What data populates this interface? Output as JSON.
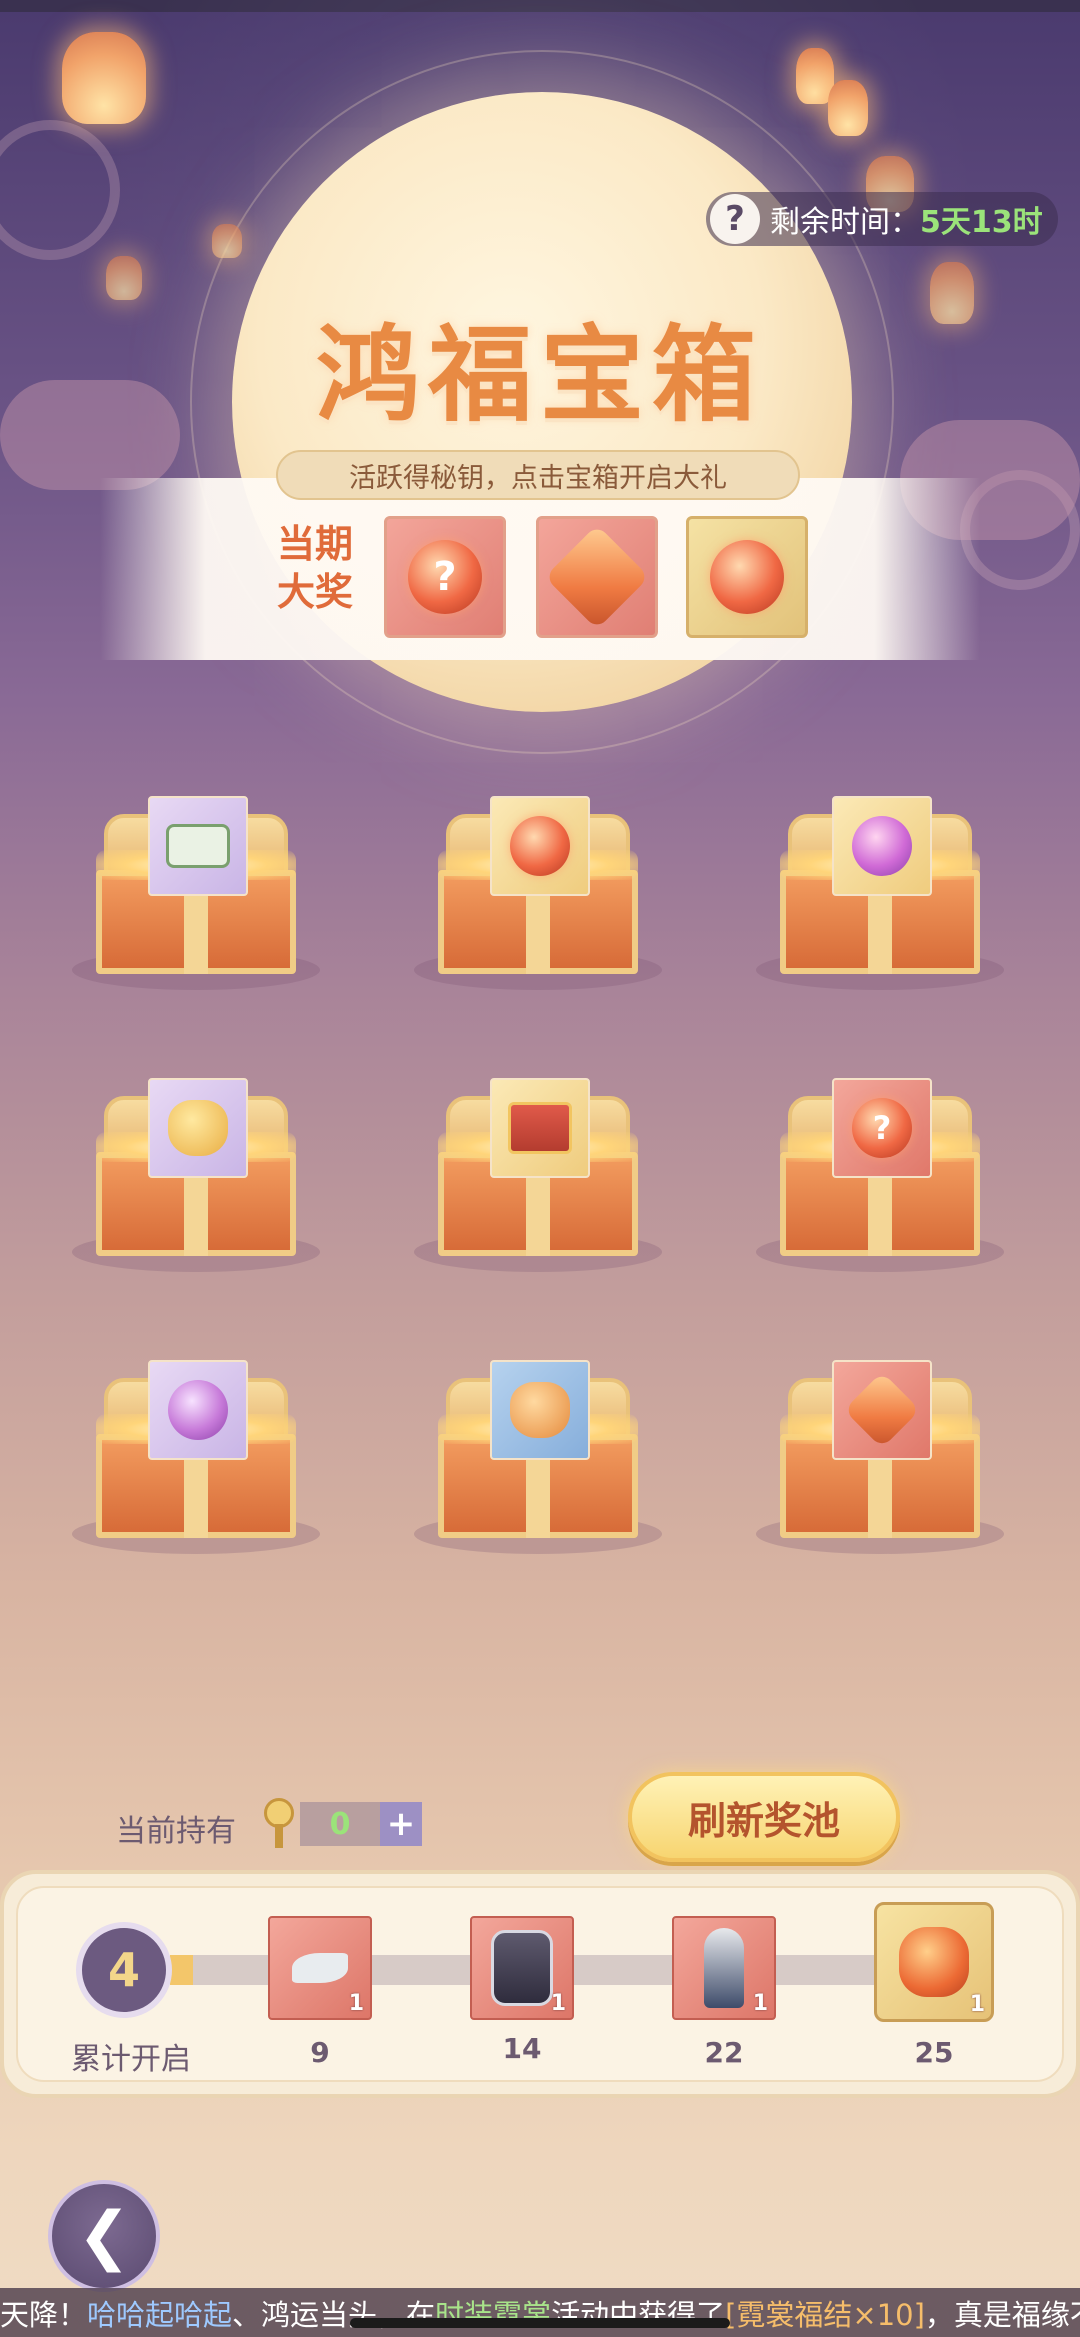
{
  "header": {
    "timer_label": "剩余时间：",
    "timer_value": "5天13时",
    "title": "鸿福宝箱",
    "subtitle": "活跃得秘钥，点击宝箱开启大礼",
    "grand_prize_label_line1": "当期",
    "grand_prize_label_line2": "大奖"
  },
  "grand_prizes": [
    {
      "name": "mystery-orb",
      "color": "#e07f74"
    },
    {
      "name": "amber-gem",
      "color": "#e07f74"
    },
    {
      "name": "red-orb-stand",
      "color": "#e2c27a"
    }
  ],
  "chests": [
    {
      "item": "scroll",
      "card": "purple"
    },
    {
      "item": "red-orb",
      "card": "gold"
    },
    {
      "item": "peach",
      "card": "gold"
    },
    {
      "item": "gold-bag",
      "card": "purple"
    },
    {
      "item": "mini-chest",
      "card": "gold"
    },
    {
      "item": "mystery-orb",
      "card": "red"
    },
    {
      "item": "purple-crystal",
      "card": "purple"
    },
    {
      "item": "star-bag",
      "card": "blue"
    },
    {
      "item": "amber-gem",
      "card": "red"
    }
  ],
  "wallet": {
    "label": "当前持有",
    "key_count": "0",
    "plus": "+"
  },
  "refresh_button": "刷新奖池",
  "progress": {
    "opened_count": "4",
    "opened_label": "累计开启",
    "fill_fraction": 0.03,
    "milestones": [
      {
        "threshold": "9",
        "qty": "1",
        "item": "silver-ornament"
      },
      {
        "threshold": "14",
        "qty": "1",
        "item": "wolf-backpack"
      },
      {
        "threshold": "22",
        "qty": "1",
        "item": "character-outfit"
      },
      {
        "threshold": "25",
        "qty": "1",
        "item": "fortune-pouch"
      }
    ]
  },
  "ticker": {
    "part1": "天降！",
    "name": "哈哈起哈起",
    "part2": "、鸿运当头，在",
    "event": "时装霓裳",
    "part3": "活动中获得了",
    "item": "[霓裳福结×10]",
    "part4": "，真是福缘不"
  },
  "colors": {
    "accent_green": "#9be37a",
    "title_orange": "#e88a43",
    "button_gold": "#f7d571"
  }
}
